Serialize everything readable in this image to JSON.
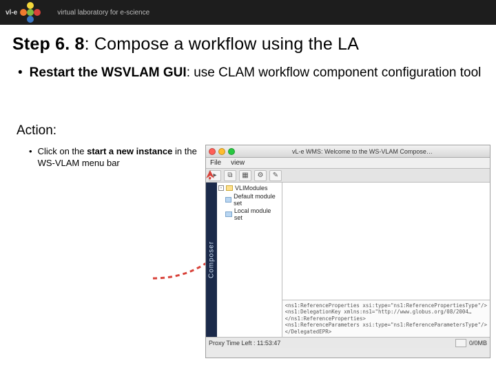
{
  "header": {
    "brand": "vl-e",
    "tagline": "virtual laboratory for e-science"
  },
  "slide": {
    "title_step": "Step 6. 8",
    "title_rest": ": Compose a workflow using the LA",
    "bullet_strong": "Restart the WSVLAM GUI",
    "bullet_rest": ": use CLAM workflow component configuration tool",
    "action_label": "Action:",
    "action_pre": "Click on the ",
    "action_strong": "start a new instance",
    "action_post": " in the WS-VLAM menu bar"
  },
  "shot": {
    "window_title": "vL-e WMS: Welcome to the WS-VLAM Compose…",
    "menu": {
      "file": "File",
      "view": "view"
    },
    "vstrip": "Composer",
    "tree": {
      "root": "VLIModules",
      "items": [
        "Default module set",
        "Local module set"
      ]
    },
    "ref": [
      "<ns1:ReferenceProperties xsi:type=\"ns1:ReferencePropertiesType\"/>",
      "<ns1:DelegationKey xmlns:ns1=\"http://www.globus.org/08/2004…",
      "</ns1:ReferenceProperties>",
      "<ns1:ReferenceParameters xsi:type=\"ns1:ReferenceParametersType\"/>",
      "</DelegatedEPR>"
    ],
    "status": {
      "left": "Proxy Time Left : 11:53:47",
      "right": "0/0MB"
    }
  }
}
